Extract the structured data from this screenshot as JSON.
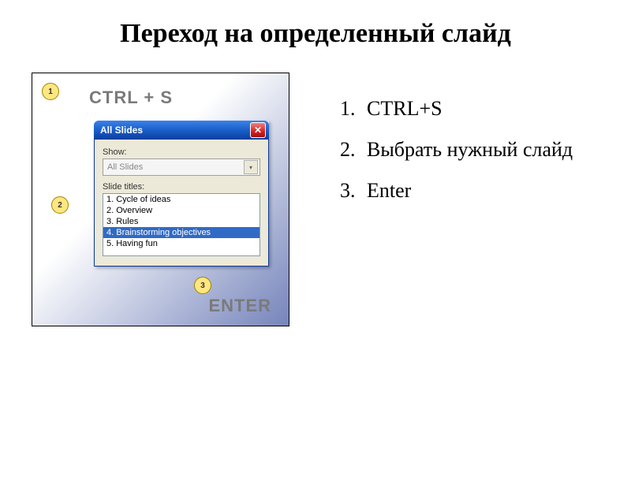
{
  "title": "Переход на определенный слайд",
  "callouts": {
    "c1": "1",
    "c2": "2",
    "c3": "3"
  },
  "keys": {
    "ctrl_s": "CTRL + S",
    "enter": "ENTER"
  },
  "dialog": {
    "title": "All Slides",
    "show_label": "Show:",
    "show_value": "All Slides",
    "titles_label": "Slide titles:",
    "items": [
      "1. Cycle of ideas",
      "2. Overview",
      "3. Rules",
      "4. Brainstorming objectives",
      "5. Having fun"
    ],
    "selected_index": 3
  },
  "steps": [
    "CTRL+S",
    "Выбрать нужный слайд",
    "Enter"
  ]
}
